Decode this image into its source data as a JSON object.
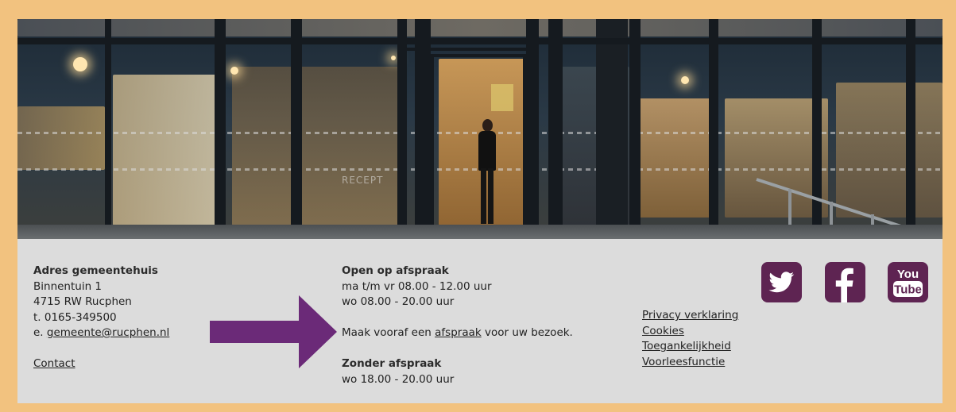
{
  "banner": {
    "image_alt": "Gemeentehuis entree bij avond",
    "sign_text": "RECEPT"
  },
  "address": {
    "title": "Adres gemeentehuis",
    "street": "Binnentuin 1",
    "postal": "4715 RW Rucphen",
    "phone": "t. 0165-349500",
    "email_prefix": "e. ",
    "email": "gemeente@rucphen.nl",
    "contact_link": "Contact"
  },
  "hours": {
    "appointment_title": "Open op afspraak",
    "line1": "ma t/m vr 08.00 - 12.00 uur",
    "line2": "wo 08.00 - 20.00 uur",
    "note_before": "Maak vooraf een ",
    "note_link": "afspraak",
    "note_after": " voor uw bezoek.",
    "walkin_title": "Zonder afspraak",
    "walkin_line": "wo 18.00 - 20.00 uur"
  },
  "footer_links": [
    "Privacy verklaring",
    "Cookies",
    "Toegankelijkheid",
    "Voorleesfunctie"
  ],
  "social": {
    "twitter": "twitter-icon",
    "facebook": "facebook-icon",
    "youtube": "youtube-icon",
    "youtube_text_top": "You",
    "youtube_text_bottom": "Tube",
    "color": "#5e2452"
  },
  "colors": {
    "frame": "#f2c27f",
    "panel": "#dcdcdc",
    "arrow": "#6b2a78"
  }
}
